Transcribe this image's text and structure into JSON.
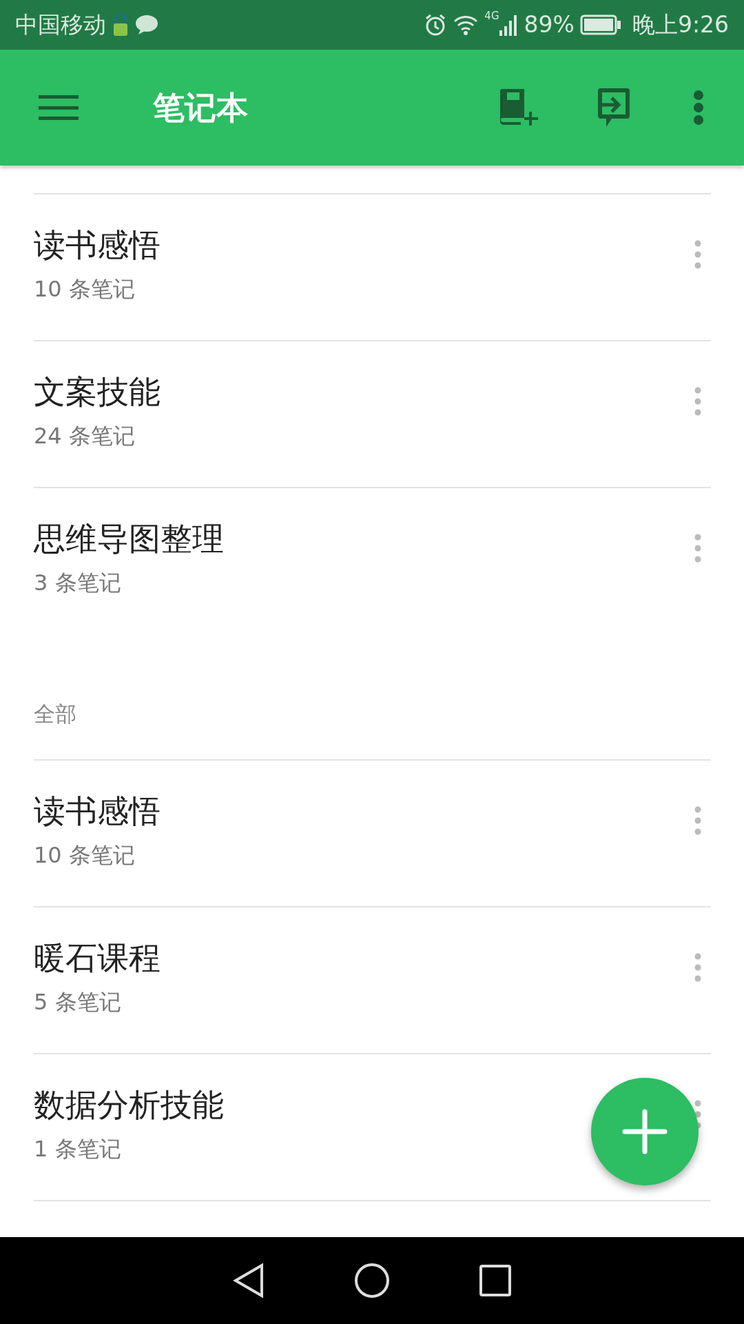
{
  "status_bar": {
    "carrier": "中国移动",
    "network": "4G",
    "battery": "89%",
    "time": "晚上9:26"
  },
  "toolbar": {
    "title": "笔记本"
  },
  "sections": [
    {
      "items": [
        {
          "title": "读书感悟",
          "count": "10 条笔记"
        },
        {
          "title": "文案技能",
          "count": "24 条笔记"
        },
        {
          "title": "思维导图整理",
          "count": "3 条笔记"
        }
      ]
    },
    {
      "header": "全部",
      "items": [
        {
          "title": "读书感悟",
          "count": "10 条笔记"
        },
        {
          "title": "暖石课程",
          "count": "5 条笔记"
        },
        {
          "title": "数据分析技能",
          "count": "1 条笔记"
        }
      ]
    }
  ]
}
